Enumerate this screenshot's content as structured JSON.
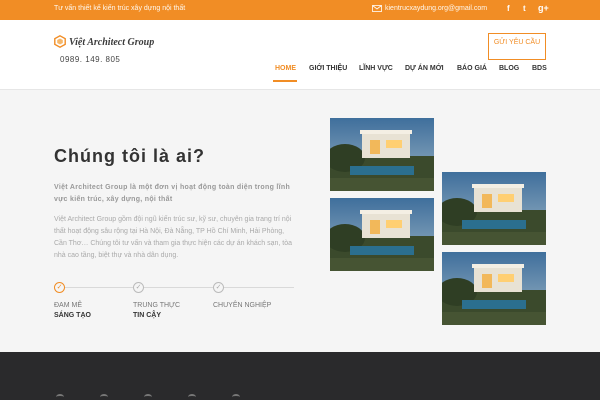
{
  "topbar": {
    "tagline": "Tư vấn thiết kế kiến trúc xây dựng nội thất",
    "email": "kientruc­xaydung.org@gmail.com",
    "social": [
      "f",
      "t",
      "g+"
    ],
    "background": "#f18d25"
  },
  "header": {
    "logo_text": "Việt Architect Group",
    "phone": "0989. 149. 805",
    "cta_label": "GỬI YÊU CẦU",
    "nav": [
      "HOME",
      "GIỚI THIỆU",
      "LĨNH VỰC",
      "DỰ ÁN MỚI",
      "BÁO GIÁ",
      "BLOG",
      "BDS"
    ],
    "active_nav": "HOME",
    "accent": "#f18d25"
  },
  "main": {
    "heading": "Chúng tôi là ai?",
    "intro": "Việt Architect Group là một đơn vị hoạt động toàn diện trong lĩnh vực kiến trúc, xây dựng, nội thất",
    "description": "Việt Architect Group gồm đội ngũ kiến trúc sư, kỹ sư, chuyên gia trang trí nội thất hoạt động sâu rộng tại Hà Nội, Đà Nẵng, TP Hồ Chí Minh, Hải Phòng, Cần Thơ… Chúng tôi tư vấn và tham gia thực hiện các dự án khách sạn, tòa nhà cao tầng, biệt thự và nhà dân dụng.",
    "steps": [
      {
        "label": "ĐAM MÊ",
        "sub": "SÁNG TẠO",
        "icon": "check-icon"
      },
      {
        "label": "TRUNG THỰC",
        "sub": "TIN CẬY",
        "icon": "check-icon"
      },
      {
        "label": "CHUYÊN NGHIỆP",
        "sub": "",
        "icon": "check-icon"
      }
    ],
    "photos": [
      "villa-photo",
      "villa-photo",
      "villa-photo",
      "villa-photo"
    ]
  }
}
